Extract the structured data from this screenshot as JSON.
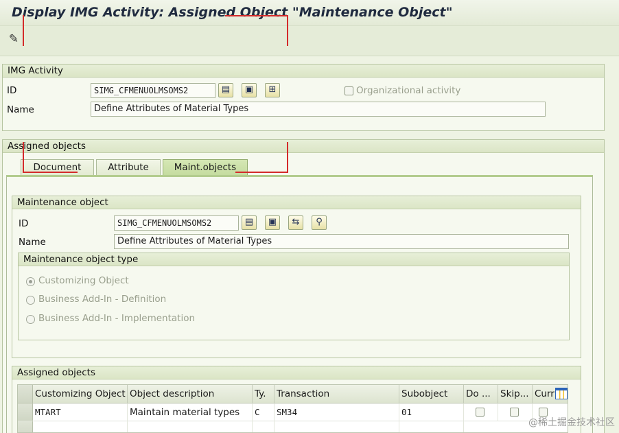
{
  "title": "Display IMG Activity: Assigned Object \"Maintenance Object\"",
  "toolbar": {
    "icon": "display-change-icon"
  },
  "img_activity": {
    "group_title": "IMG Activity",
    "id_label": "ID",
    "id_value": "SIMG_CFMENUOLMSOMS2",
    "name_label": "Name",
    "name_value": "Define Attributes of Material Types",
    "org_activity_label": "Organizational activity"
  },
  "assigned_objects": {
    "group_title": "Assigned objects",
    "tabs": [
      {
        "label": "Document"
      },
      {
        "label": "Attribute"
      },
      {
        "label": "Maint.objects"
      }
    ]
  },
  "maintenance_object": {
    "group_title": "Maintenance object",
    "id_label": "ID",
    "id_value": "SIMG_CFMENUOLMSOMS2",
    "name_label": "Name",
    "name_value": "Define Attributes of Material Types",
    "type_group_title": "Maintenance object type",
    "types": [
      {
        "label": "Customizing Object",
        "selected": true
      },
      {
        "label": "Business Add-In - Definition",
        "selected": false
      },
      {
        "label": "Business Add-In - Implementation",
        "selected": false
      }
    ]
  },
  "assigned_table": {
    "group_title": "Assigned objects",
    "columns": [
      "Customizing Object",
      "Object description",
      "Ty.",
      "Transaction",
      "Subobject",
      "Do ...",
      "Skip...",
      "Curr"
    ],
    "rows": [
      {
        "object": "MTART",
        "description": "Maintain material types",
        "type": "C",
        "transaction": "SM34",
        "subobject": "01"
      }
    ]
  },
  "watermark": "@稀土掘金技术社区",
  "colors": {
    "annotation_red": "#d42a2a",
    "active_tab": "#c5dca0"
  }
}
